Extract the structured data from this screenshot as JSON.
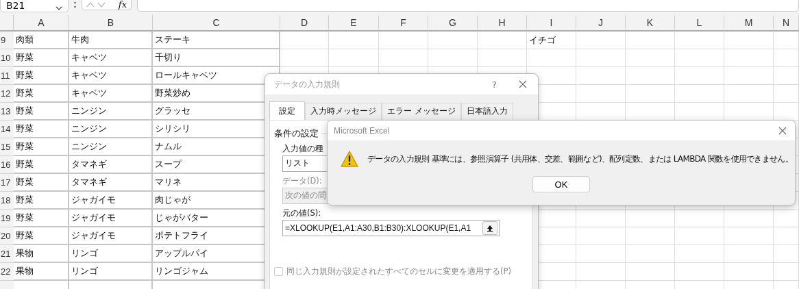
{
  "name_box": {
    "value": "B21"
  },
  "formula_bar": {
    "function_label": "fx"
  },
  "columns": [
    "A",
    "B",
    "C",
    "D",
    "E",
    "F",
    "G",
    "H",
    "I",
    "J",
    "K",
    "L",
    "M",
    "N"
  ],
  "rows": [
    {
      "number": "9",
      "column_a": "肉類",
      "column_b": "牛肉",
      "column_c": "ステーキ",
      "column_i": "イチゴ"
    },
    {
      "number": "10",
      "column_a": "野菜",
      "column_b": "キャベツ",
      "column_c": "千切り"
    },
    {
      "number": "11",
      "column_a": "野菜",
      "column_b": "キャベツ",
      "column_c": "ロールキャベツ"
    },
    {
      "number": "12",
      "column_a": "野菜",
      "column_b": "キャベツ",
      "column_c": "野菜炒め"
    },
    {
      "number": "13",
      "column_a": "野菜",
      "column_b": "ニンジン",
      "column_c": "グラッセ"
    },
    {
      "number": "14",
      "column_a": "野菜",
      "column_b": "ニンジン",
      "column_c": "シリシリ"
    },
    {
      "number": "15",
      "column_a": "野菜",
      "column_b": "ニンジン",
      "column_c": "ナムル"
    },
    {
      "number": "16",
      "column_a": "野菜",
      "column_b": "タマネギ",
      "column_c": "スープ"
    },
    {
      "number": "17",
      "column_a": "野菜",
      "column_b": "タマネギ",
      "column_c": "マリネ"
    },
    {
      "number": "18",
      "column_a": "野菜",
      "column_b": "ジャガイモ",
      "column_c": "肉じゃが"
    },
    {
      "number": "19",
      "column_a": "野菜",
      "column_b": "ジャガイモ",
      "column_c": "じゃがバター"
    },
    {
      "number": "20",
      "column_a": "野菜",
      "column_b": "ジャガイモ",
      "column_c": "ポテトフライ"
    },
    {
      "number": "21",
      "column_a": "果物",
      "column_b": "リンゴ",
      "column_c": "アップルパイ"
    },
    {
      "number": "22",
      "column_a": "果物",
      "column_b": "リンゴ",
      "column_c": "リンゴジャム"
    }
  ],
  "validation_dialog": {
    "title": "データの入力規則",
    "help": "?",
    "tabs": [
      {
        "label": "設定",
        "selected": true
      },
      {
        "label": "入力時メッセージ",
        "selected": false
      },
      {
        "label": "エラー メッセージ",
        "selected": false
      },
      {
        "label": "日本語入力",
        "selected": false
      }
    ],
    "group_label": "条件の設定",
    "allow_label": "入力値の種",
    "allow_value": "リスト",
    "data_label": "データ(D):",
    "data_value": "次の値の間",
    "data_disabled": true,
    "source_label": "元の値(S):",
    "source_value": "=XLOOKUP(E1,A1:A30,B1:B30):XLOOKUP(E1,A1",
    "apply_all": {
      "label": "同じ入力規則が設定されたすべてのセルに変更を適用する(P)",
      "checked": false,
      "disabled": true
    }
  },
  "message_box": {
    "title": "Microsoft Excel",
    "message": "データの入力規則 基準には、参照演算子 (共用体、交差、範囲など)、配列定数、または LAMBDA 関数を使用できません。",
    "button": "OK"
  }
}
